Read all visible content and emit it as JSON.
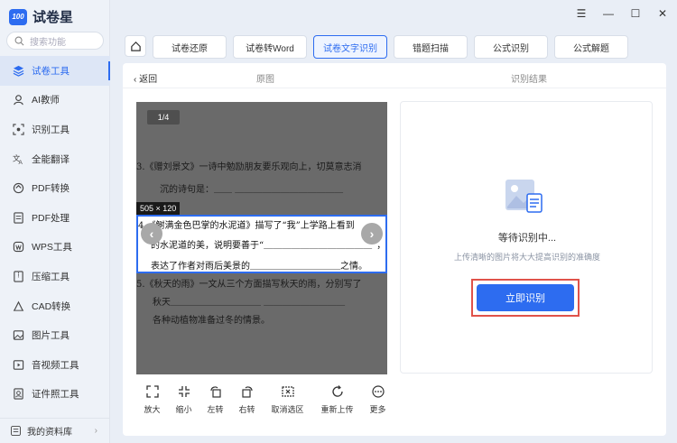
{
  "app": {
    "name": "试卷星",
    "logo_text": "100"
  },
  "search": {
    "placeholder": "搜索功能"
  },
  "sidebar": {
    "items": [
      {
        "label": "试卷工具",
        "icon": "layers-icon",
        "active": true
      },
      {
        "label": "AI教师",
        "icon": "robot-icon"
      },
      {
        "label": "识别工具",
        "icon": "scan-icon"
      },
      {
        "label": "全能翻译",
        "icon": "translate-icon"
      },
      {
        "label": "PDF转换",
        "icon": "convert-icon"
      },
      {
        "label": "PDF处理",
        "icon": "pdf-icon"
      },
      {
        "label": "WPS工具",
        "icon": "wps-icon"
      },
      {
        "label": "压缩工具",
        "icon": "compress-icon"
      },
      {
        "label": "CAD转换",
        "icon": "cad-icon"
      },
      {
        "label": "图片工具",
        "icon": "image-icon"
      },
      {
        "label": "音视频工具",
        "icon": "video-icon"
      },
      {
        "label": "证件照工具",
        "icon": "id-photo-icon"
      }
    ],
    "library": "我的资料库"
  },
  "tabs": [
    "试卷还原",
    "试卷转Word",
    "试卷文字识别",
    "错题扫描",
    "公式识别",
    "公式解题"
  ],
  "active_tab": "试卷文字识别",
  "header": {
    "back": "返回",
    "original": "原图",
    "result": "识别结果"
  },
  "preview": {
    "page_indicator": "1/4",
    "selection_size": "505 × 120",
    "lines": [
      "3.《赠刘景文》一诗中勉励朋友要乐观向上，切莫意志消",
      "沉的诗句是：＿＿ ＿＿＿＿＿＿＿＿＿＿＿＿",
      "4.《鲥满金色巴掌的水泥道》描写了“我”上学路上看到",
      "的水泥道的美，说明要善于“＿＿＿＿＿＿＿＿＿＿＿＿”，",
      "表达了作者对雨后美景的＿＿＿＿＿＿＿＿＿＿之情。",
      "5.《秋天的雨》一文从三个方面描写秋天的雨，分别写了",
      "秋天＿＿＿＿＿＿＿＿＿＿ ＿＿＿＿＿＿＿＿＿",
      "各种动植物准备过冬的情景。"
    ]
  },
  "tools": [
    {
      "label": "放大",
      "icon": "expand-icon"
    },
    {
      "label": "缩小",
      "icon": "shrink-icon"
    },
    {
      "label": "左转",
      "icon": "rotate-left-icon"
    },
    {
      "label": "右转",
      "icon": "rotate-right-icon"
    },
    {
      "label": "取消选区",
      "icon": "cancel-selection-icon"
    },
    {
      "label": "重新上传",
      "icon": "reupload-icon"
    },
    {
      "label": "更多",
      "icon": "more-icon"
    }
  ],
  "result": {
    "status": "等待识别中...",
    "hint": "上传清晰的图片将大大提高识别的准确度",
    "button": "立即识别"
  },
  "colors": {
    "accent": "#2d6cf0",
    "highlight": "#e0524a"
  }
}
